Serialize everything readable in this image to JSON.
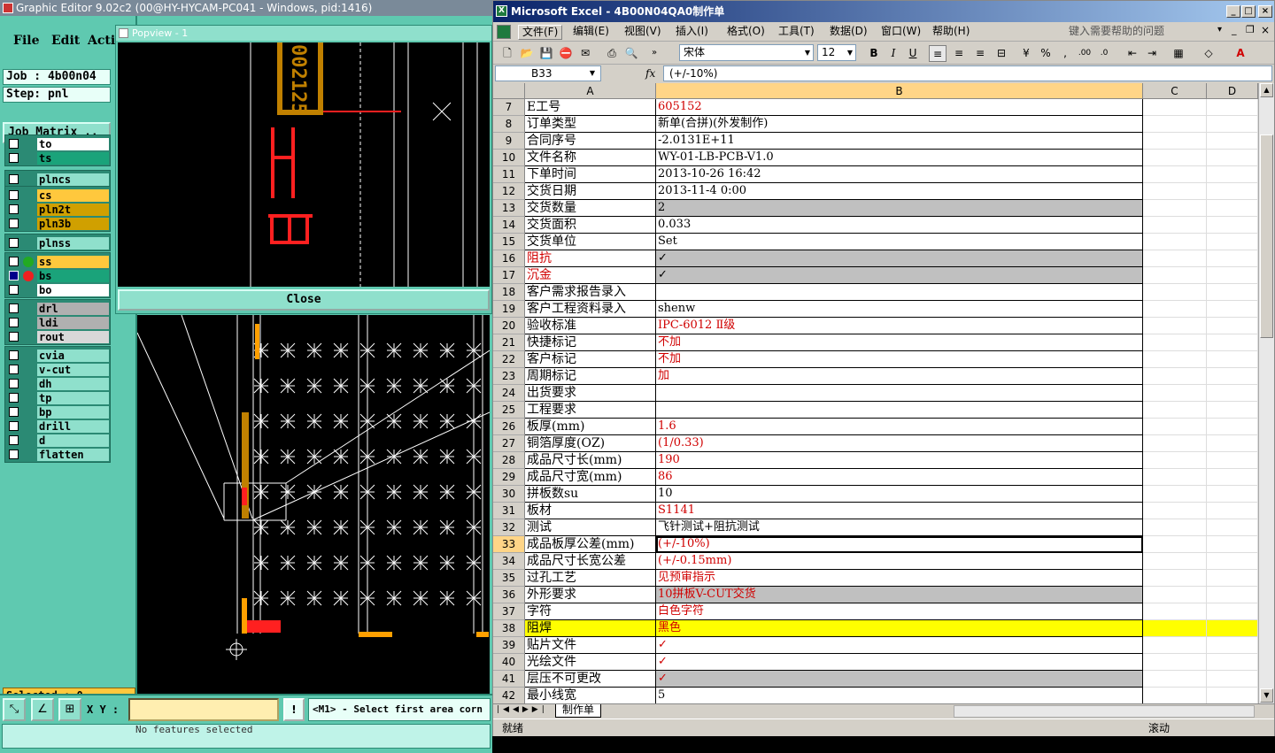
{
  "graphic_editor": {
    "title": "Graphic Editor 9.02c2 (00@HY-HYCAM-PC041 - Windows, pid:1416)",
    "menu": [
      "File",
      "Edit",
      "Acti"
    ],
    "job": "Job : 4b00n04",
    "step": "Step: pnl",
    "job_matrix_label": "Job Matrix ..",
    "layers": [
      {
        "name": "to",
        "color": "#ffffff"
      },
      {
        "name": "ts",
        "color": "#1aa37a"
      },
      {
        "name": "plncs",
        "color": "#8fe0cc"
      },
      {
        "name": "cs",
        "color": "#ffc83d"
      },
      {
        "name": "pln2t",
        "color": "#d0a000"
      },
      {
        "name": "pln3b",
        "color": "#d0a000"
      },
      {
        "name": "plnss",
        "color": "#8fe0cc"
      },
      {
        "name": "ss",
        "color": "#ffc83d"
      },
      {
        "name": "bs",
        "color": "#1aa37a"
      },
      {
        "name": "bo",
        "color": "#ffffff"
      },
      {
        "name": "drl",
        "color": "#b0b0b0"
      },
      {
        "name": "ldi",
        "color": "#b0b0b0"
      },
      {
        "name": "rout",
        "color": "#d8d8d8"
      },
      {
        "name": "cvia",
        "color": "#8fe0cc"
      },
      {
        "name": "v-cut",
        "color": "#8fe0cc"
      },
      {
        "name": "dh",
        "color": "#8fe0cc"
      },
      {
        "name": "tp",
        "color": "#8fe0cc"
      },
      {
        "name": "bp",
        "color": "#8fe0cc"
      },
      {
        "name": "drill",
        "color": "#8fe0cc"
      },
      {
        "name": "d",
        "color": "#8fe0cc"
      },
      {
        "name": "flatten",
        "color": "#8fe0cc"
      }
    ],
    "selected": "Selected : 0",
    "xy_label": "X Y :",
    "warn_icon": "!",
    "prompt": "<M1> - Select first area corn",
    "status": "No features selected",
    "popview": {
      "title": "Popview - 1",
      "close_label": "Close",
      "board_text": "002125"
    }
  },
  "excel": {
    "title": "Microsoft Excel - 4B00N04QA0制作单",
    "menu": [
      "文件(F)",
      "编辑(E)",
      "视图(V)",
      "插入(I)",
      "格式(O)",
      "工具(T)",
      "数据(D)",
      "窗口(W)",
      "帮助(H)"
    ],
    "help_placeholder": "键入需要帮助的问题",
    "font_name": "宋体",
    "font_size": "12",
    "name_box": "B33",
    "fx": "fx",
    "formula": "(+/-10%)",
    "columns": [
      "A",
      "B",
      "C",
      "D"
    ],
    "rows": [
      {
        "n": "7",
        "a": "E工号",
        "b": "605152",
        "red_a": false,
        "red_b": true,
        "fill": ""
      },
      {
        "n": "8",
        "a": "订单类型",
        "b": "新单(合拼)(外发制作)",
        "red_a": false,
        "red_b": false,
        "fill": ""
      },
      {
        "n": "9",
        "a": "合同序号",
        "b": "-2.0131E+11",
        "red_a": false,
        "red_b": false,
        "fill": ""
      },
      {
        "n": "10",
        "a": "文件名称",
        "b": "WY-01-LB-PCB-V1.0",
        "red_a": false,
        "red_b": false,
        "fill": ""
      },
      {
        "n": "11",
        "a": "下单时间",
        "b": "2013-10-26 16:42",
        "red_a": false,
        "red_b": false,
        "fill": ""
      },
      {
        "n": "12",
        "a": "交货日期",
        "b": "2013-11-4 0:00",
        "red_a": false,
        "red_b": false,
        "fill": ""
      },
      {
        "n": "13",
        "a": "交货数量",
        "b": "2",
        "red_a": false,
        "red_b": false,
        "fill": "gray"
      },
      {
        "n": "14",
        "a": "交货面积",
        "b": "0.033",
        "red_a": false,
        "red_b": false,
        "fill": ""
      },
      {
        "n": "15",
        "a": "交货单位",
        "b": "Set",
        "red_a": false,
        "red_b": false,
        "fill": ""
      },
      {
        "n": "16",
        "a": "阻抗",
        "b": "✓",
        "red_a": true,
        "red_b": false,
        "fill": "gray"
      },
      {
        "n": "17",
        "a": "沉金",
        "b": "✓",
        "red_a": true,
        "red_b": false,
        "fill": "gray"
      },
      {
        "n": "18",
        "a": "客户需求报告录入",
        "b": "",
        "red_a": false,
        "red_b": false,
        "fill": ""
      },
      {
        "n": "19",
        "a": "客户工程资料录入",
        "b": "shenw",
        "red_a": false,
        "red_b": false,
        "fill": ""
      },
      {
        "n": "20",
        "a": "验收标准",
        "b": "IPC-6012 Ⅱ级",
        "red_a": false,
        "red_b": true,
        "fill": ""
      },
      {
        "n": "21",
        "a": "快捷标记",
        "b": "不加",
        "red_a": false,
        "red_b": true,
        "fill": ""
      },
      {
        "n": "22",
        "a": "客户标记",
        "b": "不加",
        "red_a": false,
        "red_b": true,
        "fill": ""
      },
      {
        "n": "23",
        "a": "周期标记",
        "b": "加",
        "red_a": false,
        "red_b": true,
        "fill": ""
      },
      {
        "n": "24",
        "a": "出货要求",
        "b": "",
        "red_a": false,
        "red_b": false,
        "fill": ""
      },
      {
        "n": "25",
        "a": "工程要求",
        "b": "",
        "red_a": false,
        "red_b": false,
        "fill": ""
      },
      {
        "n": "26",
        "a": "板厚(mm)",
        "b": "1.6",
        "red_a": false,
        "red_b": true,
        "fill": ""
      },
      {
        "n": "27",
        "a": "铜箔厚度(OZ)",
        "b": "(1/0.33)",
        "red_a": false,
        "red_b": true,
        "fill": ""
      },
      {
        "n": "28",
        "a": "成品尺寸长(mm)",
        "b": "190",
        "red_a": false,
        "red_b": true,
        "fill": ""
      },
      {
        "n": "29",
        "a": "成品尺寸宽(mm)",
        "b": "86",
        "red_a": false,
        "red_b": true,
        "fill": ""
      },
      {
        "n": "30",
        "a": "拼板数su",
        "b": "10",
        "red_a": false,
        "red_b": false,
        "fill": ""
      },
      {
        "n": "31",
        "a": "板材",
        "b": "S1141",
        "red_a": false,
        "red_b": true,
        "fill": ""
      },
      {
        "n": "32",
        "a": "测试",
        "b": "飞针测试+阻抗测试",
        "red_a": false,
        "red_b": false,
        "fill": ""
      },
      {
        "n": "33",
        "a": "成品板厚公差(mm)",
        "b": "(+/-10%)",
        "red_a": false,
        "red_b": true,
        "fill": "",
        "selected": true
      },
      {
        "n": "34",
        "a": "成品尺寸长宽公差",
        "b": "(+/-0.15mm)",
        "red_a": false,
        "red_b": true,
        "fill": ""
      },
      {
        "n": "35",
        "a": "过孔工艺",
        "b": "见预审指示",
        "red_a": false,
        "red_b": true,
        "fill": ""
      },
      {
        "n": "36",
        "a": "外形要求",
        "b": "10拼板V-CUT交货",
        "red_a": false,
        "red_b": true,
        "fill": "gray"
      },
      {
        "n": "37",
        "a": "字符",
        "b": "白色字符",
        "red_a": false,
        "red_b": true,
        "fill": ""
      },
      {
        "n": "38",
        "a": "阻焊",
        "b": "黑色",
        "red_a": false,
        "red_b": true,
        "fill": "yellow"
      },
      {
        "n": "39",
        "a": "贴片文件",
        "b": "✓",
        "red_a": false,
        "red_b": true,
        "fill": ""
      },
      {
        "n": "40",
        "a": "光绘文件",
        "b": "✓",
        "red_a": false,
        "red_b": true,
        "fill": ""
      },
      {
        "n": "41",
        "a": "层压不可更改",
        "b": "✓",
        "red_a": false,
        "red_b": true,
        "fill": "gray"
      },
      {
        "n": "42",
        "a": "最小线宽",
        "b": "5",
        "red_a": false,
        "red_b": false,
        "fill": ""
      }
    ],
    "sheet_tab": "制作单",
    "status_left": "就绪",
    "status_right": "滚动"
  }
}
